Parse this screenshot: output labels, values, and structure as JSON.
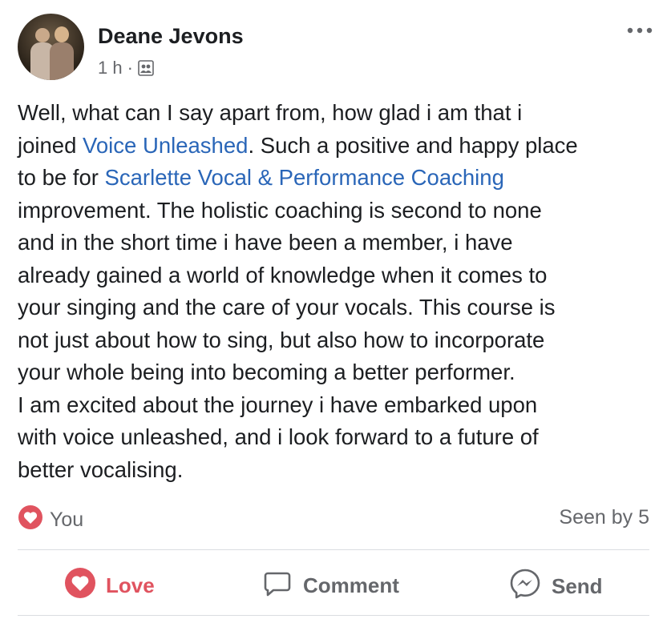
{
  "post": {
    "author": "Deane Jevons",
    "time": "1 h",
    "separator": "·",
    "privacy_icon": "group-icon",
    "more_icon": "more-options-icon",
    "text_parts": [
      "Well, what can I say apart from, how glad i am that i\njoined ",
      "Voice Unleashed",
      ". Such a positive and happy place\nto be for ",
      "Scarlette Vocal & Performance Coaching",
      "\nimprovement. The holistic coaching is second to none\nand in the short time i have been a member, i have\nalready gained a world of knowledge when it comes to\nyour singing and the care of your vocals. This course is\nnot just about how to sing, but also how to incorporate\nyour whole being into becoming a better performer.\nI am excited about the journey i have embarked upon\nwith voice unleashed, and i look forward to a future of\nbetter vocalising."
    ]
  },
  "reactions": {
    "icon": "heart-reaction-icon",
    "label": "You",
    "seen": "Seen by 5"
  },
  "actions": {
    "love": "Love",
    "comment": "Comment",
    "send": "Send"
  },
  "colors": {
    "link": "#2a66b8",
    "love": "#e0535f",
    "muted": "#65676b"
  }
}
